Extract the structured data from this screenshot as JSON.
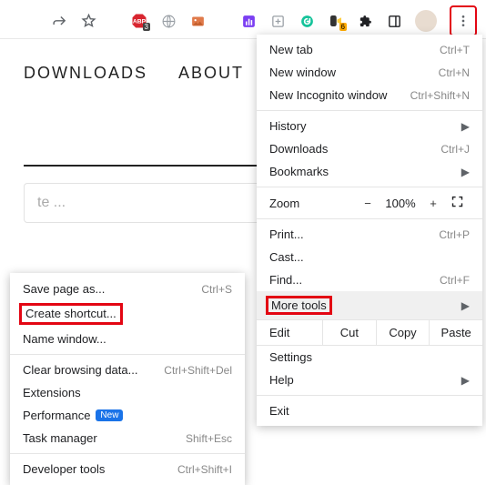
{
  "toolbar": {
    "adblock_badge": "3",
    "video_badge": "6"
  },
  "page": {
    "nav1": "DOWNLOADS",
    "nav2": "ABOUT",
    "input_placeholder": "te ..."
  },
  "menu": {
    "new_tab": "New tab",
    "new_tab_hint": "Ctrl+T",
    "new_window": "New window",
    "new_window_hint": "Ctrl+N",
    "incognito": "New Incognito window",
    "incognito_hint": "Ctrl+Shift+N",
    "history": "History",
    "downloads": "Downloads",
    "downloads_hint": "Ctrl+J",
    "bookmarks": "Bookmarks",
    "zoom_label": "Zoom",
    "zoom_minus": "−",
    "zoom_pct": "100%",
    "zoom_plus": "+",
    "print": "Print...",
    "print_hint": "Ctrl+P",
    "cast": "Cast...",
    "find": "Find...",
    "find_hint": "Ctrl+F",
    "more_tools": "More tools",
    "edit": "Edit",
    "cut": "Cut",
    "copy": "Copy",
    "paste": "Paste",
    "settings": "Settings",
    "help": "Help",
    "exit": "Exit"
  },
  "submenu": {
    "save_page": "Save page as...",
    "save_page_hint": "Ctrl+S",
    "create_shortcut": "Create shortcut...",
    "name_window": "Name window...",
    "clear_data": "Clear browsing data...",
    "clear_data_hint": "Ctrl+Shift+Del",
    "extensions": "Extensions",
    "performance": "Performance",
    "new_badge": "New",
    "task_manager": "Task manager",
    "task_manager_hint": "Shift+Esc",
    "developer_tools": "Developer tools",
    "developer_tools_hint": "Ctrl+Shift+I"
  }
}
